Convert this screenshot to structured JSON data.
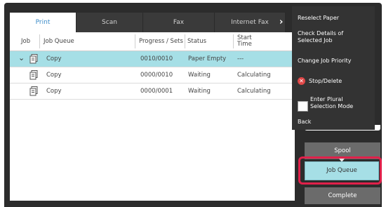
{
  "tabs": [
    {
      "label": "Print",
      "active": true
    },
    {
      "label": "Scan",
      "active": false
    },
    {
      "label": "Fax",
      "active": false
    },
    {
      "label": "Internet Fax",
      "active": false
    }
  ],
  "table": {
    "headers": {
      "job": "Job",
      "job_queue": "Job Queue",
      "progress": "Progress / Sets",
      "status": "Status",
      "start_time_line1": "Start",
      "start_time_line2": "Time"
    },
    "rows": [
      {
        "selected": true,
        "name": "Copy",
        "progress": "0010/0010",
        "status": "Paper Empty",
        "start_time": "---"
      },
      {
        "selected": false,
        "name": "Copy",
        "progress": "0000/0010",
        "status": "Waiting",
        "start_time": "Calculating"
      },
      {
        "selected": false,
        "name": "Copy",
        "progress": "0000/0001",
        "status": "Waiting",
        "start_time": "Calculating"
      }
    ]
  },
  "menu": {
    "reselect_paper": "Reselect Paper",
    "check_details_l1": "Check Details of",
    "check_details_l2": "Selected Job",
    "change_priority": "Change Job Priority",
    "stop_delete": "Stop/Delete",
    "plural_l1": "Enter Plural",
    "plural_l2": "Selection Mode",
    "back": "Back"
  },
  "side_buttons": {
    "spool": "Spool",
    "job_queue": "Job Queue",
    "complete": "Complete"
  },
  "icons": {
    "stop": "x-circle-icon",
    "document": "document-copy-icon",
    "selected": "chevron-down-icon",
    "more": "chevron-right-icon"
  },
  "colors": {
    "selection": "#a6dfe6",
    "highlight_outline": "#e0204a",
    "active_tab_text": "#3b8bc8"
  }
}
